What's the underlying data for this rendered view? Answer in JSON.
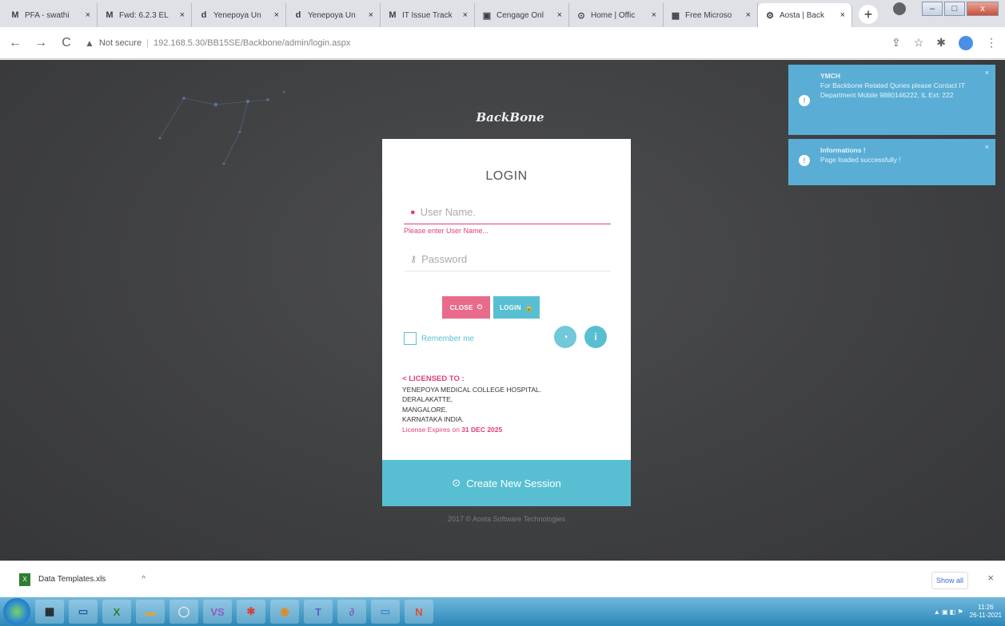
{
  "browser": {
    "tabs": [
      {
        "label": "PFA - swathi",
        "icon": "M"
      },
      {
        "label": "Fwd: 6.2.3 EL",
        "icon": "M"
      },
      {
        "label": "Yenepoya Un",
        "icon": "d"
      },
      {
        "label": "Yenepoya Un",
        "icon": "d"
      },
      {
        "label": "IT Issue Track",
        "icon": "M"
      },
      {
        "label": "Cengage Onl",
        "icon": "▣"
      },
      {
        "label": "Home | Offic",
        "icon": "⊙"
      },
      {
        "label": "Free Microso",
        "icon": "▦"
      },
      {
        "label": "Aosta | Back",
        "icon": "⚙",
        "active": true
      }
    ],
    "tab_close": "×",
    "new_tab": "+",
    "window": {
      "minimize": "–",
      "maximize": "□",
      "close": "x"
    },
    "nav": {
      "back": "←",
      "forward": "→",
      "reload": "C"
    },
    "address": {
      "warning_icon": "▲",
      "security": "Not secure",
      "separator": "|",
      "url": "192.168.5.30/BB15SE/Backbone/admin/login.aspx"
    },
    "right_icons": {
      "share": "⇪",
      "star": "☆",
      "extensions": "✱",
      "menu": "⋮"
    }
  },
  "page": {
    "logo": "BackBone",
    "login": {
      "title": "LOGIN",
      "user_placeholder": "User Name.",
      "user_icon": "●",
      "user_error": "Please enter User Name...",
      "password_placeholder": "Password",
      "password_icon": "⚷",
      "close_label": "CLOSE",
      "close_icon": "⏻",
      "login_label": "LOGIN",
      "login_icon": "🔓",
      "remember_label": "Remember me",
      "circle1_icon": "◔",
      "circle2_icon": "i"
    },
    "license": {
      "heading": "LICENSED TO :",
      "heading_icon": "<",
      "lines": [
        "YENEPOYA MEDICAL COLLEGE HOSPITAL.",
        "DERALAKATTE,",
        "MANGALORE.",
        "KARNATAKA INDIA."
      ],
      "expiry_prefix": "License Expires on",
      "expiry_date": "31 DEC 2025"
    },
    "session_button": {
      "label": "Create New Session",
      "icon": "⊙"
    },
    "footer": "2017 © Aosta Software Technologies"
  },
  "toasts": [
    {
      "title": "YMCH",
      "body": "For Backbone Related Quries please Contact IT Department Mobile 9880146222, IL Ext: 222",
      "icon": "!",
      "close": "×"
    },
    {
      "title": "Informations !",
      "body": "Page loaded successfully !",
      "icon": "!",
      "close": "×"
    }
  ],
  "downloads": {
    "file_name": "Data Templates.xls",
    "chevron": "^",
    "show_all": "Show all",
    "close": "×",
    "file_icon": "X"
  },
  "taskbar": {
    "apps": [
      {
        "icon": "▦",
        "color": "#222"
      },
      {
        "icon": "▭",
        "color": "#1d5fa6"
      },
      {
        "icon": "X",
        "color": "#2e7d32"
      },
      {
        "icon": "▬",
        "color": "#d8a63a"
      },
      {
        "icon": "◯",
        "color": "#e8e8e8"
      },
      {
        "icon": "VS",
        "color": "#8e5cc2"
      },
      {
        "icon": "✱",
        "color": "#d0463a"
      },
      {
        "icon": "◉",
        "color": "#e5891e"
      },
      {
        "icon": "T",
        "color": "#5a60c8"
      },
      {
        "icon": "∂",
        "color": "#7c5cc2"
      },
      {
        "icon": "▭",
        "color": "#3a8ed0"
      },
      {
        "icon": "N",
        "color": "#e24c30"
      }
    ],
    "time": "11:26",
    "date": "26-11-2021",
    "tray_icons": "▲ ▣ ◧ ⚑"
  }
}
